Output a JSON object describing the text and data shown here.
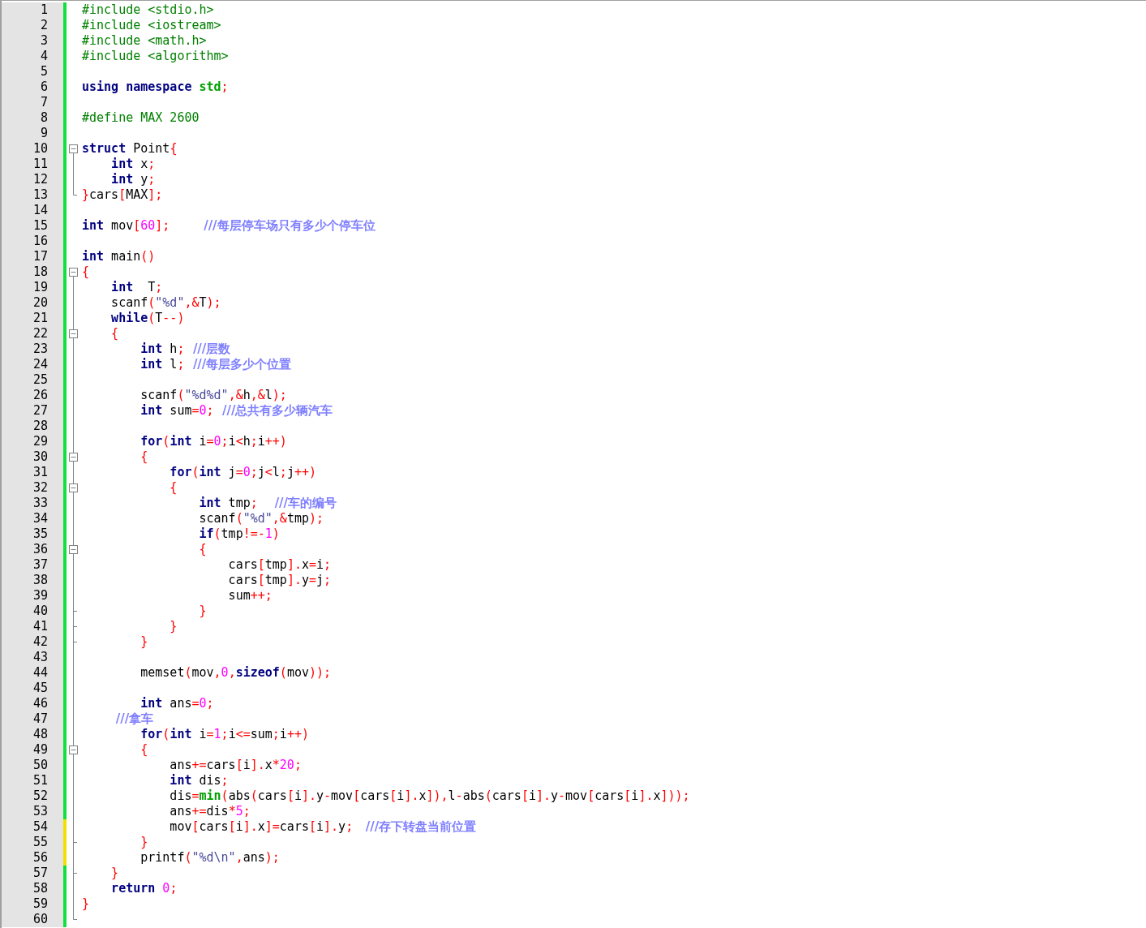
{
  "editor": {
    "lines": [
      {
        "number": "1",
        "modified": false,
        "fold_start": false,
        "fold_end": false,
        "tokens": [
          {
            "kind": "pre",
            "text": "#include <stdio.h>"
          }
        ]
      },
      {
        "number": "2",
        "modified": false,
        "fold_start": false,
        "fold_end": false,
        "tokens": [
          {
            "kind": "pre",
            "text": "#include <iostream>"
          }
        ]
      },
      {
        "number": "3",
        "modified": false,
        "fold_start": false,
        "fold_end": false,
        "tokens": [
          {
            "kind": "pre",
            "text": "#include <math.h>"
          }
        ]
      },
      {
        "number": "4",
        "modified": false,
        "fold_start": false,
        "fold_end": false,
        "tokens": [
          {
            "kind": "pre",
            "text": "#include <algorithm>"
          }
        ]
      },
      {
        "number": "5",
        "modified": false,
        "fold_start": false,
        "fold_end": false
      },
      {
        "number": "6",
        "modified": false,
        "fold_start": false,
        "fold_end": false,
        "tokens": [
          {
            "kind": "kw",
            "text": "using"
          },
          {
            "kind": "kw",
            "text": " namespace"
          },
          {
            "kind": "fn",
            "text": " std"
          },
          {
            "kind": "op",
            "text": ";"
          }
        ]
      },
      {
        "number": "7",
        "modified": false,
        "fold_start": false,
        "fold_end": false
      },
      {
        "number": "8",
        "modified": false,
        "fold_start": false,
        "fold_end": false,
        "tokens": [
          {
            "kind": "pre",
            "text": "#define MAX 2600"
          }
        ]
      },
      {
        "number": "9",
        "modified": false,
        "fold_start": false,
        "fold_end": false
      },
      {
        "number": "10",
        "modified": false,
        "fold_start": true,
        "fold_end": false,
        "tokens": [
          {
            "kind": "kw",
            "text": "struct"
          },
          {
            "kind": "txt",
            "text": " Point"
          },
          {
            "kind": "op",
            "text": "{"
          }
        ]
      },
      {
        "number": "11",
        "modified": false,
        "fold_start": false,
        "fold_end": false,
        "tokens": [
          {
            "kind": "kw",
            "text": "    int"
          },
          {
            "kind": "txt",
            "text": " x"
          },
          {
            "kind": "op",
            "text": ";"
          }
        ]
      },
      {
        "number": "12",
        "modified": false,
        "fold_start": false,
        "fold_end": false,
        "tokens": [
          {
            "kind": "kw",
            "text": "    int"
          },
          {
            "kind": "txt",
            "text": " y"
          },
          {
            "kind": "op",
            "text": ";"
          }
        ]
      },
      {
        "number": "13",
        "modified": false,
        "fold_start": false,
        "fold_end": true,
        "tokens": [
          {
            "kind": "op",
            "text": "}"
          },
          {
            "kind": "txt",
            "text": "cars"
          },
          {
            "kind": "op",
            "text": "["
          },
          {
            "kind": "txt",
            "text": "MAX"
          },
          {
            "kind": "op",
            "text": "];"
          }
        ]
      },
      {
        "number": "14",
        "modified": false,
        "fold_start": false,
        "fold_end": false
      },
      {
        "number": "15",
        "modified": false,
        "fold_start": false,
        "fold_end": false,
        "tokens": [
          {
            "kind": "kw",
            "text": "int"
          },
          {
            "kind": "txt",
            "text": " mov"
          },
          {
            "kind": "op",
            "text": "["
          },
          {
            "kind": "num",
            "text": "60"
          },
          {
            "kind": "op",
            "text": "];"
          },
          {
            "kind": "cmt",
            "text": "        ///每层停车场只有多少个停车位"
          }
        ]
      },
      {
        "number": "16",
        "modified": false,
        "fold_start": false,
        "fold_end": false
      },
      {
        "number": "17",
        "modified": false,
        "fold_start": false,
        "fold_end": false,
        "tokens": [
          {
            "kind": "kw",
            "text": "int"
          },
          {
            "kind": "txt",
            "text": " main"
          },
          {
            "kind": "op",
            "text": "()"
          }
        ]
      },
      {
        "number": "18",
        "modified": false,
        "fold_start": true,
        "fold_end": false,
        "tokens": [
          {
            "kind": "op",
            "text": "{"
          }
        ]
      },
      {
        "number": "19",
        "modified": false,
        "fold_start": false,
        "fold_end": false,
        "tokens": [
          {
            "kind": "kw",
            "text": "    int"
          },
          {
            "kind": "txt",
            "text": "  T"
          },
          {
            "kind": "op",
            "text": ";"
          }
        ]
      },
      {
        "number": "20",
        "modified": false,
        "fold_start": false,
        "fold_end": false,
        "tokens": [
          {
            "kind": "txt",
            "text": "    scanf"
          },
          {
            "kind": "op",
            "text": "("
          },
          {
            "kind": "str",
            "text": "\"%d\""
          },
          {
            "kind": "op",
            "text": ",&"
          },
          {
            "kind": "txt",
            "text": "T"
          },
          {
            "kind": "op",
            "text": ");"
          }
        ]
      },
      {
        "number": "21",
        "modified": false,
        "fold_start": false,
        "fold_end": false,
        "tokens": [
          {
            "kind": "kw",
            "text": "    while"
          },
          {
            "kind": "op",
            "text": "("
          },
          {
            "kind": "txt",
            "text": "T"
          },
          {
            "kind": "op",
            "text": "--)"
          }
        ]
      },
      {
        "number": "22",
        "modified": false,
        "fold_start": true,
        "fold_end": false,
        "tokens": [
          {
            "kind": "op",
            "text": "    {"
          }
        ]
      },
      {
        "number": "23",
        "modified": false,
        "fold_start": false,
        "fold_end": false,
        "tokens": [
          {
            "kind": "kw",
            "text": "        int"
          },
          {
            "kind": "txt",
            "text": " h"
          },
          {
            "kind": "op",
            "text": ";"
          },
          {
            "kind": "cmt",
            "text": "  ///层数"
          }
        ]
      },
      {
        "number": "24",
        "modified": false,
        "fold_start": false,
        "fold_end": false,
        "tokens": [
          {
            "kind": "kw",
            "text": "        int"
          },
          {
            "kind": "txt",
            "text": " l"
          },
          {
            "kind": "op",
            "text": ";"
          },
          {
            "kind": "cmt",
            "text": "  ///每层多少个位置"
          }
        ]
      },
      {
        "number": "25",
        "modified": false,
        "fold_start": false,
        "fold_end": false
      },
      {
        "number": "26",
        "modified": false,
        "fold_start": false,
        "fold_end": false,
        "tokens": [
          {
            "kind": "txt",
            "text": "        scanf"
          },
          {
            "kind": "op",
            "text": "("
          },
          {
            "kind": "str",
            "text": "\"%d%d\""
          },
          {
            "kind": "op",
            "text": ",&"
          },
          {
            "kind": "txt",
            "text": "h"
          },
          {
            "kind": "op",
            "text": ",&"
          },
          {
            "kind": "txt",
            "text": "l"
          },
          {
            "kind": "op",
            "text": ");"
          }
        ]
      },
      {
        "number": "27",
        "modified": false,
        "fold_start": false,
        "fold_end": false,
        "tokens": [
          {
            "kind": "kw",
            "text": "        int"
          },
          {
            "kind": "txt",
            "text": " sum"
          },
          {
            "kind": "op",
            "text": "="
          },
          {
            "kind": "num",
            "text": "0"
          },
          {
            "kind": "op",
            "text": ";"
          },
          {
            "kind": "cmt",
            "text": "  ///总共有多少辆汽车"
          }
        ]
      },
      {
        "number": "28",
        "modified": false,
        "fold_start": false,
        "fold_end": false
      },
      {
        "number": "29",
        "modified": false,
        "fold_start": false,
        "fold_end": false,
        "tokens": [
          {
            "kind": "kw",
            "text": "        for"
          },
          {
            "kind": "op",
            "text": "("
          },
          {
            "kind": "kw",
            "text": "int"
          },
          {
            "kind": "txt",
            "text": " i"
          },
          {
            "kind": "op",
            "text": "="
          },
          {
            "kind": "num",
            "text": "0"
          },
          {
            "kind": "op",
            "text": ";"
          },
          {
            "kind": "txt",
            "text": "i"
          },
          {
            "kind": "op",
            "text": "<"
          },
          {
            "kind": "txt",
            "text": "h"
          },
          {
            "kind": "op",
            "text": ";"
          },
          {
            "kind": "txt",
            "text": "i"
          },
          {
            "kind": "op",
            "text": "++)"
          }
        ]
      },
      {
        "number": "30",
        "modified": false,
        "fold_start": true,
        "fold_end": false,
        "tokens": [
          {
            "kind": "op",
            "text": "        {"
          }
        ]
      },
      {
        "number": "31",
        "modified": false,
        "fold_start": false,
        "fold_end": false,
        "tokens": [
          {
            "kind": "kw",
            "text": "            for"
          },
          {
            "kind": "op",
            "text": "("
          },
          {
            "kind": "kw",
            "text": "int"
          },
          {
            "kind": "txt",
            "text": " j"
          },
          {
            "kind": "op",
            "text": "="
          },
          {
            "kind": "num",
            "text": "0"
          },
          {
            "kind": "op",
            "text": ";"
          },
          {
            "kind": "txt",
            "text": "j"
          },
          {
            "kind": "op",
            "text": "<"
          },
          {
            "kind": "txt",
            "text": "l"
          },
          {
            "kind": "op",
            "text": ";"
          },
          {
            "kind": "txt",
            "text": "j"
          },
          {
            "kind": "op",
            "text": "++)"
          }
        ]
      },
      {
        "number": "32",
        "modified": false,
        "fold_start": true,
        "fold_end": false,
        "tokens": [
          {
            "kind": "op",
            "text": "            {"
          }
        ]
      },
      {
        "number": "33",
        "modified": false,
        "fold_start": false,
        "fold_end": false,
        "tokens": [
          {
            "kind": "kw",
            "text": "                int"
          },
          {
            "kind": "txt",
            "text": " tmp"
          },
          {
            "kind": "op",
            "text": ";"
          },
          {
            "kind": "cmt",
            "text": "    ///车的编号"
          }
        ]
      },
      {
        "number": "34",
        "modified": false,
        "fold_start": false,
        "fold_end": false,
        "tokens": [
          {
            "kind": "txt",
            "text": "                scanf"
          },
          {
            "kind": "op",
            "text": "("
          },
          {
            "kind": "str",
            "text": "\"%d\""
          },
          {
            "kind": "op",
            "text": ",&"
          },
          {
            "kind": "txt",
            "text": "tmp"
          },
          {
            "kind": "op",
            "text": ");"
          }
        ]
      },
      {
        "number": "35",
        "modified": false,
        "fold_start": false,
        "fold_end": false,
        "tokens": [
          {
            "kind": "kw",
            "text": "                if"
          },
          {
            "kind": "op",
            "text": "("
          },
          {
            "kind": "txt",
            "text": "tmp"
          },
          {
            "kind": "op",
            "text": "!=-"
          },
          {
            "kind": "num",
            "text": "1"
          },
          {
            "kind": "op",
            "text": ")"
          }
        ]
      },
      {
        "number": "36",
        "modified": false,
        "fold_start": true,
        "fold_end": false,
        "tokens": [
          {
            "kind": "op",
            "text": "                {"
          }
        ]
      },
      {
        "number": "37",
        "modified": false,
        "fold_start": false,
        "fold_end": false,
        "tokens": [
          {
            "kind": "txt",
            "text": "                    cars"
          },
          {
            "kind": "op",
            "text": "["
          },
          {
            "kind": "txt",
            "text": "tmp"
          },
          {
            "kind": "op",
            "text": "]."
          },
          {
            "kind": "txt",
            "text": "x"
          },
          {
            "kind": "op",
            "text": "="
          },
          {
            "kind": "txt",
            "text": "i"
          },
          {
            "kind": "op",
            "text": ";"
          }
        ]
      },
      {
        "number": "38",
        "modified": false,
        "fold_start": false,
        "fold_end": false,
        "tokens": [
          {
            "kind": "txt",
            "text": "                    cars"
          },
          {
            "kind": "op",
            "text": "["
          },
          {
            "kind": "txt",
            "text": "tmp"
          },
          {
            "kind": "op",
            "text": "]."
          },
          {
            "kind": "txt",
            "text": "y"
          },
          {
            "kind": "op",
            "text": "="
          },
          {
            "kind": "txt",
            "text": "j"
          },
          {
            "kind": "op",
            "text": ";"
          }
        ]
      },
      {
        "number": "39",
        "modified": false,
        "fold_start": false,
        "fold_end": false,
        "tokens": [
          {
            "kind": "txt",
            "text": "                    sum"
          },
          {
            "kind": "op",
            "text": "++;"
          }
        ]
      },
      {
        "number": "40",
        "modified": false,
        "fold_start": false,
        "fold_end": true,
        "tokens": [
          {
            "kind": "op",
            "text": "                }"
          }
        ]
      },
      {
        "number": "41",
        "modified": false,
        "fold_start": false,
        "fold_end": true,
        "tokens": [
          {
            "kind": "op",
            "text": "            }"
          }
        ]
      },
      {
        "number": "42",
        "modified": false,
        "fold_start": false,
        "fold_end": true,
        "tokens": [
          {
            "kind": "op",
            "text": "        }"
          }
        ]
      },
      {
        "number": "43",
        "modified": false,
        "fold_start": false,
        "fold_end": false
      },
      {
        "number": "44",
        "modified": false,
        "fold_start": false,
        "fold_end": false,
        "tokens": [
          {
            "kind": "txt",
            "text": "        memset"
          },
          {
            "kind": "op",
            "text": "("
          },
          {
            "kind": "txt",
            "text": "mov"
          },
          {
            "kind": "op",
            "text": ","
          },
          {
            "kind": "num",
            "text": "0"
          },
          {
            "kind": "op",
            "text": ","
          },
          {
            "kind": "kw",
            "text": "sizeof"
          },
          {
            "kind": "op",
            "text": "("
          },
          {
            "kind": "txt",
            "text": "mov"
          },
          {
            "kind": "op",
            "text": "));"
          }
        ]
      },
      {
        "number": "45",
        "modified": false,
        "fold_start": false,
        "fold_end": false
      },
      {
        "number": "46",
        "modified": false,
        "fold_start": false,
        "fold_end": false,
        "tokens": [
          {
            "kind": "kw",
            "text": "        int"
          },
          {
            "kind": "txt",
            "text": " ans"
          },
          {
            "kind": "op",
            "text": "="
          },
          {
            "kind": "num",
            "text": "0"
          },
          {
            "kind": "op",
            "text": ";"
          }
        ]
      },
      {
        "number": "47",
        "modified": false,
        "fold_start": false,
        "fold_end": false,
        "tokens": [
          {
            "kind": "cmt",
            "text": "        ///拿车"
          }
        ]
      },
      {
        "number": "48",
        "modified": false,
        "fold_start": false,
        "fold_end": false,
        "tokens": [
          {
            "kind": "kw",
            "text": "        for"
          },
          {
            "kind": "op",
            "text": "("
          },
          {
            "kind": "kw",
            "text": "int"
          },
          {
            "kind": "txt",
            "text": " i"
          },
          {
            "kind": "op",
            "text": "="
          },
          {
            "kind": "num",
            "text": "1"
          },
          {
            "kind": "op",
            "text": ";"
          },
          {
            "kind": "txt",
            "text": "i"
          },
          {
            "kind": "op",
            "text": "<="
          },
          {
            "kind": "txt",
            "text": "sum"
          },
          {
            "kind": "op",
            "text": ";"
          },
          {
            "kind": "txt",
            "text": "i"
          },
          {
            "kind": "op",
            "text": "++)"
          }
        ]
      },
      {
        "number": "49",
        "modified": false,
        "fold_start": true,
        "fold_end": false,
        "tokens": [
          {
            "kind": "op",
            "text": "        {"
          }
        ]
      },
      {
        "number": "50",
        "modified": false,
        "fold_start": false,
        "fold_end": false,
        "tokens": [
          {
            "kind": "txt",
            "text": "            ans"
          },
          {
            "kind": "op",
            "text": "+="
          },
          {
            "kind": "txt",
            "text": "cars"
          },
          {
            "kind": "op",
            "text": "["
          },
          {
            "kind": "txt",
            "text": "i"
          },
          {
            "kind": "op",
            "text": "]."
          },
          {
            "kind": "txt",
            "text": "x"
          },
          {
            "kind": "op",
            "text": "*"
          },
          {
            "kind": "num",
            "text": "20"
          },
          {
            "kind": "op",
            "text": ";"
          }
        ]
      },
      {
        "number": "51",
        "modified": false,
        "fold_start": false,
        "fold_end": false,
        "tokens": [
          {
            "kind": "kw",
            "text": "            int"
          },
          {
            "kind": "txt",
            "text": " dis"
          },
          {
            "kind": "op",
            "text": ";"
          }
        ]
      },
      {
        "number": "52",
        "modified": false,
        "fold_start": false,
        "fold_end": false,
        "tokens": [
          {
            "kind": "txt",
            "text": "            dis"
          },
          {
            "kind": "op",
            "text": "="
          },
          {
            "kind": "fn",
            "text": "min"
          },
          {
            "kind": "op",
            "text": "("
          },
          {
            "kind": "txt",
            "text": "abs"
          },
          {
            "kind": "op",
            "text": "("
          },
          {
            "kind": "txt",
            "text": "cars"
          },
          {
            "kind": "op",
            "text": "["
          },
          {
            "kind": "txt",
            "text": "i"
          },
          {
            "kind": "op",
            "text": "]."
          },
          {
            "kind": "txt",
            "text": "y"
          },
          {
            "kind": "op",
            "text": "-"
          },
          {
            "kind": "txt",
            "text": "mov"
          },
          {
            "kind": "op",
            "text": "["
          },
          {
            "kind": "txt",
            "text": "cars"
          },
          {
            "kind": "op",
            "text": "["
          },
          {
            "kind": "txt",
            "text": "i"
          },
          {
            "kind": "op",
            "text": "]."
          },
          {
            "kind": "txt",
            "text": "x"
          },
          {
            "kind": "op",
            "text": "]),"
          },
          {
            "kind": "txt",
            "text": "l"
          },
          {
            "kind": "op",
            "text": "-"
          },
          {
            "kind": "txt",
            "text": "abs"
          },
          {
            "kind": "op",
            "text": "("
          },
          {
            "kind": "txt",
            "text": "cars"
          },
          {
            "kind": "op",
            "text": "["
          },
          {
            "kind": "txt",
            "text": "i"
          },
          {
            "kind": "op",
            "text": "]."
          },
          {
            "kind": "txt",
            "text": "y"
          },
          {
            "kind": "op",
            "text": "-"
          },
          {
            "kind": "txt",
            "text": "mov"
          },
          {
            "kind": "op",
            "text": "["
          },
          {
            "kind": "txt",
            "text": "cars"
          },
          {
            "kind": "op",
            "text": "["
          },
          {
            "kind": "txt",
            "text": "i"
          },
          {
            "kind": "op",
            "text": "]."
          },
          {
            "kind": "txt",
            "text": "x"
          },
          {
            "kind": "op",
            "text": "]));"
          }
        ]
      },
      {
        "number": "53",
        "modified": false,
        "fold_start": false,
        "fold_end": false,
        "tokens": [
          {
            "kind": "txt",
            "text": "            ans"
          },
          {
            "kind": "op",
            "text": "+="
          },
          {
            "kind": "txt",
            "text": "dis"
          },
          {
            "kind": "op",
            "text": "*"
          },
          {
            "kind": "num",
            "text": "5"
          },
          {
            "kind": "op",
            "text": ";"
          }
        ]
      },
      {
        "number": "54",
        "modified": true,
        "fold_start": false,
        "fold_end": false,
        "tokens": [
          {
            "kind": "txt",
            "text": "            mov"
          },
          {
            "kind": "op",
            "text": "["
          },
          {
            "kind": "txt",
            "text": "cars"
          },
          {
            "kind": "op",
            "text": "["
          },
          {
            "kind": "txt",
            "text": "i"
          },
          {
            "kind": "op",
            "text": "]."
          },
          {
            "kind": "txt",
            "text": "x"
          },
          {
            "kind": "op",
            "text": "]="
          },
          {
            "kind": "txt",
            "text": "cars"
          },
          {
            "kind": "op",
            "text": "["
          },
          {
            "kind": "txt",
            "text": "i"
          },
          {
            "kind": "op",
            "text": "]."
          },
          {
            "kind": "txt",
            "text": "y"
          },
          {
            "kind": "op",
            "text": ";"
          },
          {
            "kind": "cmt",
            "text": "   ///存下转盘当前位置"
          }
        ]
      },
      {
        "number": "55",
        "modified": true,
        "fold_start": false,
        "fold_end": true,
        "tokens": [
          {
            "kind": "op",
            "text": "        }"
          }
        ]
      },
      {
        "number": "56",
        "modified": true,
        "fold_start": false,
        "fold_end": false,
        "tokens": [
          {
            "kind": "txt",
            "text": "        printf"
          },
          {
            "kind": "op",
            "text": "("
          },
          {
            "kind": "str",
            "text": "\"%d\\n\""
          },
          {
            "kind": "op",
            "text": ","
          },
          {
            "kind": "txt",
            "text": "ans"
          },
          {
            "kind": "op",
            "text": ");"
          }
        ]
      },
      {
        "number": "57",
        "modified": false,
        "fold_start": false,
        "fold_end": true,
        "tokens": [
          {
            "kind": "op",
            "text": "    }"
          }
        ]
      },
      {
        "number": "58",
        "modified": false,
        "fold_start": false,
        "fold_end": false,
        "tokens": [
          {
            "kind": "kw",
            "text": "    return"
          },
          {
            "kind": "num",
            "text": " 0"
          },
          {
            "kind": "op",
            "text": ";"
          }
        ]
      },
      {
        "number": "59",
        "modified": false,
        "fold_start": false,
        "fold_end": false,
        "tokens": [
          {
            "kind": "op",
            "text": "}"
          }
        ]
      },
      {
        "number": "60",
        "modified": false,
        "fold_start": false,
        "fold_end": true
      }
    ]
  }
}
